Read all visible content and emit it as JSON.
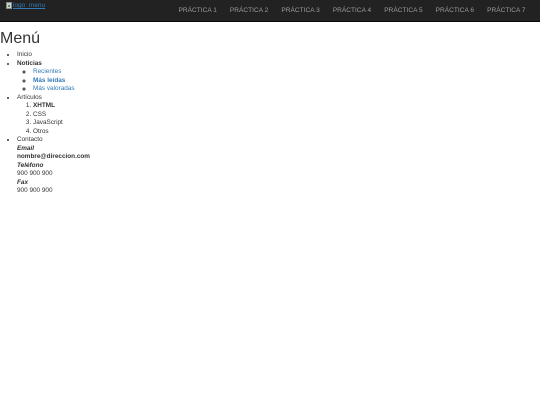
{
  "header": {
    "logo_alt": "logo_menu",
    "nav": [
      "PRÁCTICA 1",
      "PRÁCTICA 2",
      "PRÁCTICA 3",
      "PRÁCTICA 4",
      "PRÁCTICA 5",
      "PRÁCTICA 6",
      "PRÁCTICA 7"
    ]
  },
  "page": {
    "title": "Menú"
  },
  "menu": {
    "inicio": "Inicio",
    "noticias": {
      "label": "Noticias",
      "items": [
        "Recientes",
        "Más leídas",
        "Más valoradas"
      ]
    },
    "articulos": {
      "label": "Artículos",
      "items": [
        "XHTML",
        "CSS",
        "JavaScript",
        "Otros"
      ]
    },
    "contacto": {
      "label": "Contacto",
      "details": [
        {
          "term": "Email",
          "value": "nombre@direccion.com"
        },
        {
          "term": "Teléfono",
          "value": "900 900 900"
        },
        {
          "term": "Fax",
          "value": "900 900 900"
        }
      ]
    }
  },
  "colors": {
    "navbar_bg": "#222222",
    "nav_text": "#9d9d9d",
    "link": "#337ab7",
    "text": "#333333"
  }
}
